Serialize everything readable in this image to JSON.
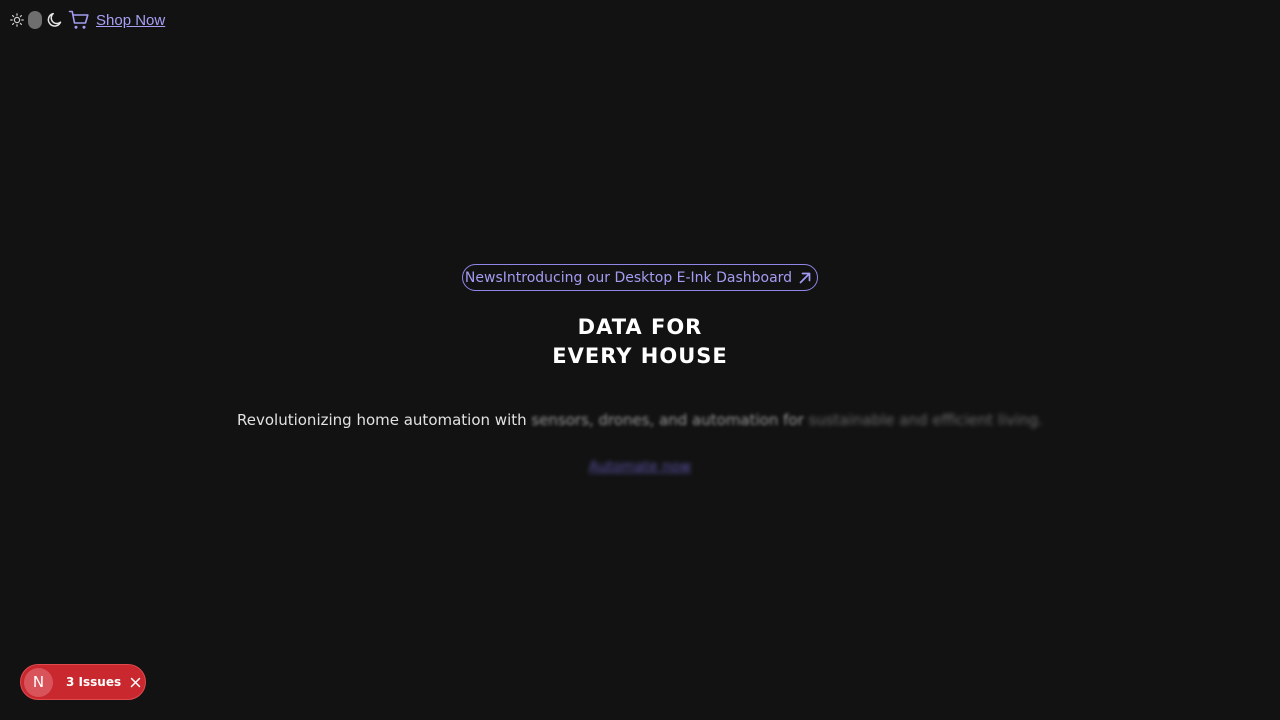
{
  "topbar": {
    "theme_light_icon": "sun-icon",
    "theme_toggle": "toggle-switch",
    "theme_dark_icon": "moon-icon",
    "cart_icon": "cart-icon",
    "shop_link": "Shop Now"
  },
  "hero": {
    "news_tag": "News",
    "news_text": "Introducing our Desktop E-Ink Dashboard",
    "news_icon": "arrow-up-right-icon",
    "headline_line1": "DATA FOR",
    "headline_line2": "EVERY HOUSE",
    "tagline_part1": "Revolutionizing home automation with ",
    "tagline_part2": "sensors, drones, and automation for ",
    "tagline_part3": "sustainable and efficient living.",
    "cta_label": "Automate now"
  },
  "dev_overlay": {
    "logo_letter": "N",
    "issues_label": "3 Issues",
    "close_icon": "close-icon"
  },
  "colors": {
    "background": "#121212",
    "accent": "#a39cf2",
    "issues_badge": "#c8282e"
  }
}
